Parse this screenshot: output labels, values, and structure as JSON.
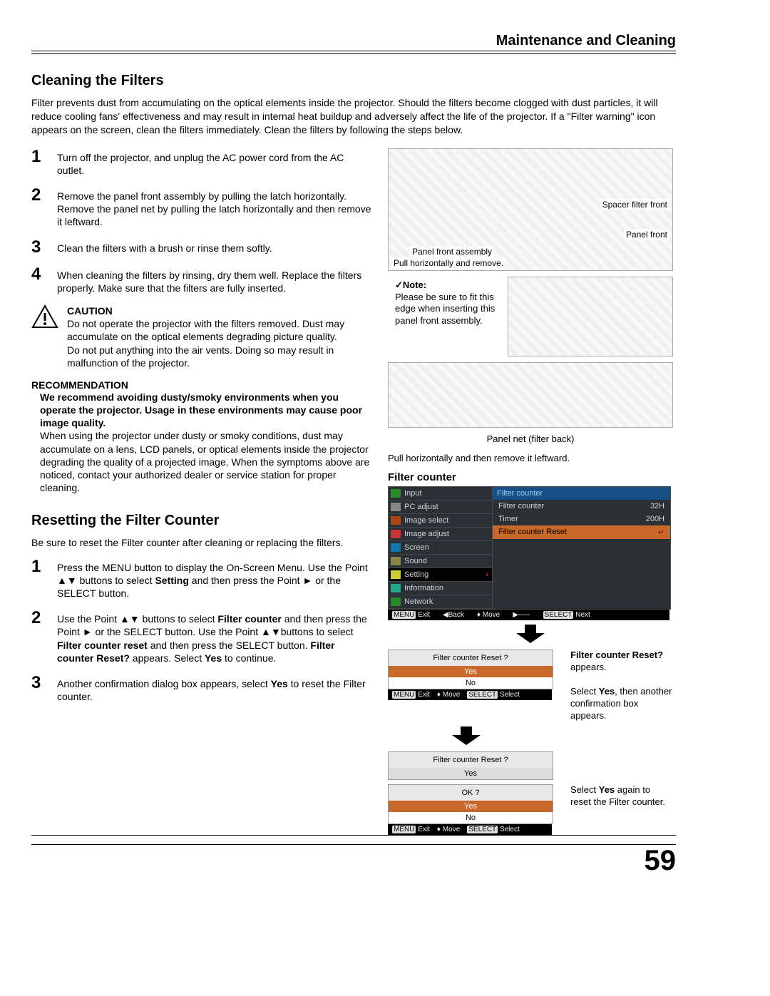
{
  "header": {
    "chapter": "Maintenance and Cleaning"
  },
  "sec1": {
    "title": "Cleaning the Filters",
    "intro": "Filter prevents dust from accumulating on the optical elements inside the projector. Should the filters become clogged with dust particles, it will reduce cooling fans' effectiveness and may result in internal heat buildup and adversely affect the life of the projector. If a \"Filter warning\" icon appears on the screen, clean the filters immediately. Clean the filters by following the steps below.",
    "steps": [
      "Turn off the projector, and unplug the AC power cord from the AC outlet.",
      "Remove the panel front assembly by pulling the latch horizontally.\nRemove the panel net  by pulling the latch horizontally and then remove it leftward.",
      "Clean the filters with a brush or rinse them softly.",
      "When cleaning the filters by rinsing, dry them well. Replace the filters properly.  Make sure that the filters are fully inserted."
    ],
    "caution": {
      "hdr": "CAUTION",
      "txt1": "Do not operate the projector with the filters removed. Dust may accumulate on the optical elements degrading picture quality.",
      "txt2": "Do not put anything into the air vents. Doing so may result in malfunction of the projector."
    },
    "reco": {
      "hdr": "RECOMMENDATION",
      "bold": "We recommend avoiding dusty/smoky environments when you operate the projector. Usage in these environments may cause poor image quality.",
      "txt": "When using the projector under dusty or smoky conditions, dust may accumulate on a lens, LCD panels, or optical elements inside the projector degrading the quality of a projected image. When the symptoms above are noticed, contact your authorized dealer or service station for proper cleaning."
    }
  },
  "sec2": {
    "title": "Resetting the Filter Counter",
    "lead": "Be sure to reset the Filter counter after cleaning or replacing the filters.",
    "step1_a": "Press the MENU button to display the On-Screen Menu. Use the Point ▲▼ buttons to select ",
    "step1_b": "Setting",
    "step1_c": " and then press the Point ► or the ",
    "step1_d": "SELECT",
    "step1_e": "  button.",
    "step2_a": "Use the Point ▲▼ buttons to select ",
    "step2_b": "Filter counter",
    "step2_c": " and then press the Point ► or the SELECT button. Use the Point ▲▼buttons to select ",
    "step2_d": "Filter counter reset",
    "step2_e": " and then press the SELECT button. ",
    "step2_f": "Filter counter Reset?",
    "step2_g": " appears. Select ",
    "step2_h": "Yes",
    "step2_i": " to continue.",
    "step3_a": "Another confirmation dialog box appears, select ",
    "step3_b": "Yes",
    "step3_c": " to reset the Filter counter."
  },
  "right": {
    "dia1": {
      "spacer": "Spacer filter front",
      "panelfront": "Panel front",
      "assembly": "Panel front assembly",
      "pull": "Pull horizontally and remove."
    },
    "note": {
      "hdr": "✓Note:",
      "txt": "Please be sure to fit this edge when inserting this panel front assembly."
    },
    "dia3": {
      "caption1": "Panel net (filter back)",
      "caption2": "Pull horizontally and then remove it leftward."
    },
    "fc_title": "Filter counter",
    "menu": {
      "left": [
        "Input",
        "PC adjust",
        "Image select",
        "Image adjust",
        "Screen",
        "Sound",
        "Setting",
        "Information",
        "Network"
      ],
      "right_hdr": "Filter counter",
      "fc": "Filter counter",
      "fc_v": "32H",
      "timer": "Timer",
      "timer_v": "200H",
      "reset": "Filter counter Reset"
    },
    "foot1": {
      "exit": "Exit",
      "back": "Back",
      "move": "Move",
      "dash": "-----",
      "next": "Next",
      "menu": "MENU",
      "sel": "SELECT"
    },
    "dlg1": {
      "q": "Filter counter  Reset ?",
      "yes": "Yes",
      "no": "No"
    },
    "foot2": {
      "exit": "Exit",
      "move": "Move",
      "select": "Select"
    },
    "side1_a": "Filter counter Reset?",
    "side1_b": " appears.",
    "side1_c": "Select ",
    "side1_d": "Yes",
    "side1_e": ", then another confirmation box appears.",
    "dlg2": {
      "q": "Filter counter  Reset ?",
      "yes": "Yes"
    },
    "dlg3": {
      "q": "OK ?",
      "yes": "Yes",
      "no": "No"
    },
    "side2_a": "Select ",
    "side2_b": "Yes",
    "side2_c": " again to reset the Filter counter."
  },
  "page_no": "59"
}
